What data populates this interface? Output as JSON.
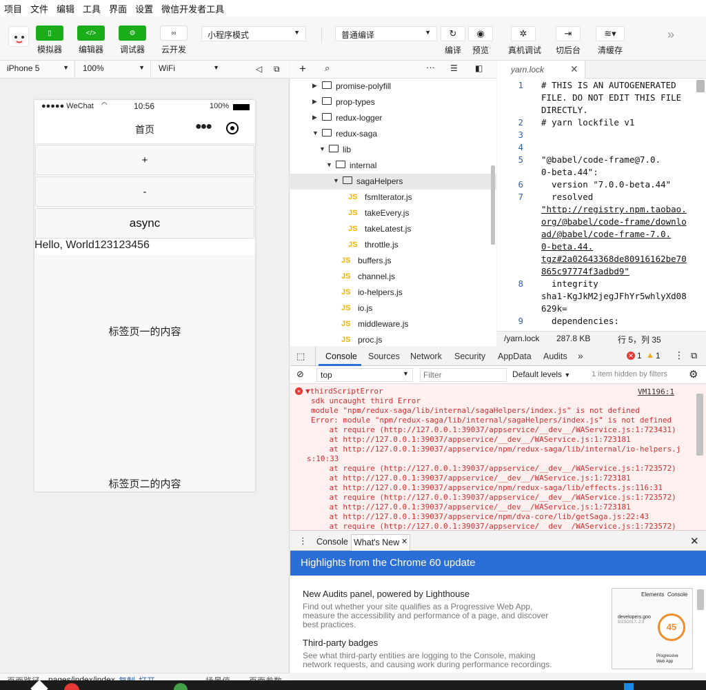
{
  "menu": [
    "项目",
    "文件",
    "编辑",
    "工具",
    "界面",
    "设置",
    "微信开发者工具"
  ],
  "toolbar": {
    "simulator": "模拟器",
    "editor": "编辑器",
    "debugger": "调试器",
    "cloud": "云开发",
    "mode": "小程序模式",
    "compile_mode": "普通编译",
    "compile": "编译",
    "preview": "预览",
    "remote_debug": "真机调试",
    "background": "切后台",
    "clear_cache": "清缓存"
  },
  "simulator": {
    "device": "iPhone 5",
    "zoom": "100%",
    "network": "WiFi",
    "status": {
      "carrier": "●●●●● WeChat",
      "time": "10:56",
      "battery": "100%"
    },
    "nav_title": "首页",
    "buttons": [
      "+",
      "-",
      "async"
    ],
    "hello": "Hello, World123123456",
    "tab1": "标签页一的内容",
    "tab2": "标签页二的内容"
  },
  "statusline": {
    "path_label": "页面路径",
    "path": "pages/index/index",
    "copy": "复制",
    "open": "打开",
    "scene": "场景值",
    "params": "页面参数"
  },
  "tree": [
    {
      "name": "promise-polyfill",
      "type": "folder",
      "open": false
    },
    {
      "name": "prop-types",
      "type": "folder",
      "open": false
    },
    {
      "name": "redux-logger",
      "type": "folder",
      "open": false
    },
    {
      "name": "redux-saga",
      "type": "folder",
      "open": true
    },
    {
      "name": "lib",
      "type": "folder",
      "open": true
    },
    {
      "name": "internal",
      "type": "folder",
      "open": true
    },
    {
      "name": "sagaHelpers",
      "type": "folder",
      "open": true
    },
    {
      "name": "fsmIterator.js",
      "type": "js"
    },
    {
      "name": "takeEvery.js",
      "type": "js"
    },
    {
      "name": "takeLatest.js",
      "type": "js"
    },
    {
      "name": "throttle.js",
      "type": "js"
    },
    {
      "name": "buffers.js",
      "type": "js"
    },
    {
      "name": "channel.js",
      "type": "js"
    },
    {
      "name": "io-helpers.js",
      "type": "js"
    },
    {
      "name": "io.js",
      "type": "js"
    },
    {
      "name": "middleware.js",
      "type": "js"
    },
    {
      "name": "proc.js",
      "type": "js"
    }
  ],
  "editor": {
    "tab": "yarn.lock",
    "line_numbers": [
      "1",
      "2",
      "3",
      "4",
      "5",
      "6",
      "7",
      "8",
      "9"
    ],
    "code": [
      "# THIS IS AN AUTOGENERATED",
      "FILE. DO NOT EDIT THIS FILE",
      "DIRECTLY.",
      "# yarn lockfile v1",
      "\"@babel/code-frame@7.0.",
      "0-beta.44\":",
      "  version \"7.0.0-beta.44\"",
      "  resolved",
      "\"http://registry.npm.taobao.",
      "org/@babel/code-frame/downlo",
      "ad/@babel/code-frame-7.0.",
      "0-beta.44.",
      "tgz#2a02643368de80916162be70",
      "865c97774f3adbd9\"",
      "  integrity",
      "sha1-KgJkM2jegJFhYr5whlyXd08",
      "629k=",
      "  dependencies:"
    ],
    "status": {
      "file": "/yarn.lock",
      "size": "287.8 KB",
      "pos": "行 5，列 35"
    }
  },
  "devtools": {
    "tabs": [
      "Console",
      "Sources",
      "Network",
      "Security",
      "AppData",
      "Audits"
    ],
    "more": "»",
    "errors": "1",
    "warnings": "1",
    "context": "top",
    "filter_placeholder": "Filter",
    "levels": "Default levels",
    "hidden": "1 item hidden by filters",
    "console_lines": [
      "▼thirdScriptError",
      "sdk uncaught third Error",
      "module \"npm/redux-saga/lib/internal/sagaHelpers/index.js\" is not defined",
      "Error: module \"npm/redux-saga/lib/internal/sagaHelpers/index.js\" is not defined",
      "    at require (http://127.0.0.1:39037/appservice/__dev__/WAService.js:1:723431)",
      "    at http://127.0.0.1:39037/appservice/__dev__/WAService.js:1:723181",
      "    at http://127.0.0.1:39037/appservice/npm/redux-saga/lib/internal/io-helpers.j",
      "s:10:33",
      "    at require (http://127.0.0.1:39037/appservice/__dev__/WAService.js:1:723572)",
      "    at http://127.0.0.1:39037/appservice/__dev__/WAService.js:1:723181",
      "    at http://127.0.0.1:39037/appservice/npm/redux-saga/lib/effects.js:116:31",
      "    at require (http://127.0.0.1:39037/appservice/__dev__/WAService.js:1:723572)",
      "    at http://127.0.0.1:39037/appservice/__dev__/WAService.js:1:723181",
      "    at http://127.0.0.1:39037/appservice/npm/dva-core/lib/getSaga.js:22:43",
      "    at require (http://127.0.0.1:39037/appservice/__dev__/WAService.js:1:723572)"
    ],
    "source_ref": "VM1196:1",
    "drawer_tabs": [
      "Console",
      "What's New"
    ],
    "banner": "Highlights from the Chrome 60 update",
    "news": [
      {
        "title": "New Audits panel, powered by Lighthouse",
        "body": [
          "Find out whether your site qualifies as a Progressive Web App,",
          "measure the accessibility and performance of a page, and discover",
          "best practices."
        ]
      },
      {
        "title": "Third-party badges",
        "body": [
          "See what third-party entities are logging to the Console, making",
          "network requests, and causing work during performance recordings."
        ]
      }
    ],
    "thumb": {
      "elements": "Elements",
      "console": "Console",
      "site": "developers.goo",
      "date": "5/23/2017, 2:3",
      "score": "45",
      "label1": "Progressive",
      "label2": "Web App"
    }
  },
  "colors": {
    "green": "#1aad19",
    "banner": "#2b6ed6",
    "error": "#d32f2f",
    "js": "#f0b400"
  }
}
